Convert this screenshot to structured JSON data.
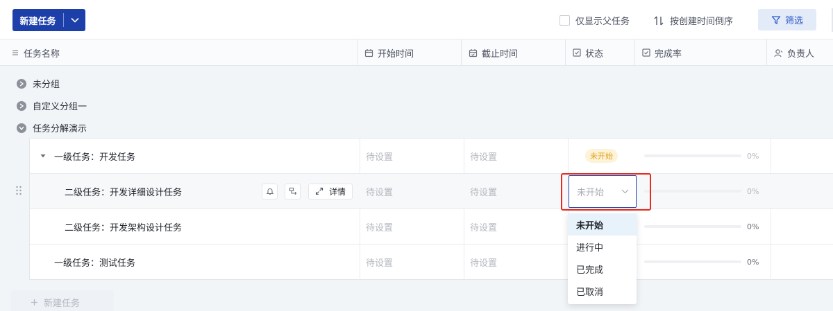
{
  "toolbar": {
    "new_task_label": "新建任务",
    "only_parent_label": "仅显示父任务",
    "sort_label": "按创建时间倒序",
    "filter_label": "筛选"
  },
  "columns": {
    "name": "任务名称",
    "start": "开始时间",
    "end": "截止时间",
    "status": "状态",
    "progress": "完成率",
    "owner": "负责人"
  },
  "groups": [
    {
      "label": "未分组"
    },
    {
      "label": "自定义分组一"
    },
    {
      "label": "任务分解演示"
    }
  ],
  "tasks": [
    {
      "name": "一级任务：开发任务",
      "start": "待设置",
      "end": "待设置",
      "status": "未开始",
      "progress": 0,
      "progress_text": "0%"
    },
    {
      "name": "二级任务：开发详细设计任务",
      "start": "待设置",
      "end": "待设置",
      "status": "未开始",
      "progress": 0,
      "progress_text": "0%"
    },
    {
      "name": "二级任务：开发架构设计任务",
      "start": "待设置",
      "end": "待设置",
      "status": "",
      "progress": 0,
      "progress_text": "0%"
    },
    {
      "name": "一级任务：测试任务",
      "start": "待设置",
      "end": "待设置",
      "status": "",
      "progress": 0,
      "progress_text": "0%"
    }
  ],
  "row_actions": {
    "detail_label": "详情"
  },
  "status_select": {
    "value": "未开始"
  },
  "status_options": [
    {
      "label": "未开始"
    },
    {
      "label": "进行中"
    },
    {
      "label": "已完成"
    },
    {
      "label": "已取消"
    }
  ],
  "add_task_label": "新建任务",
  "colors": {
    "primary": "#1d3faa",
    "highlight": "#e8291b",
    "badge_bg": "#fdf3d9",
    "badge_text": "#e2a21b"
  }
}
